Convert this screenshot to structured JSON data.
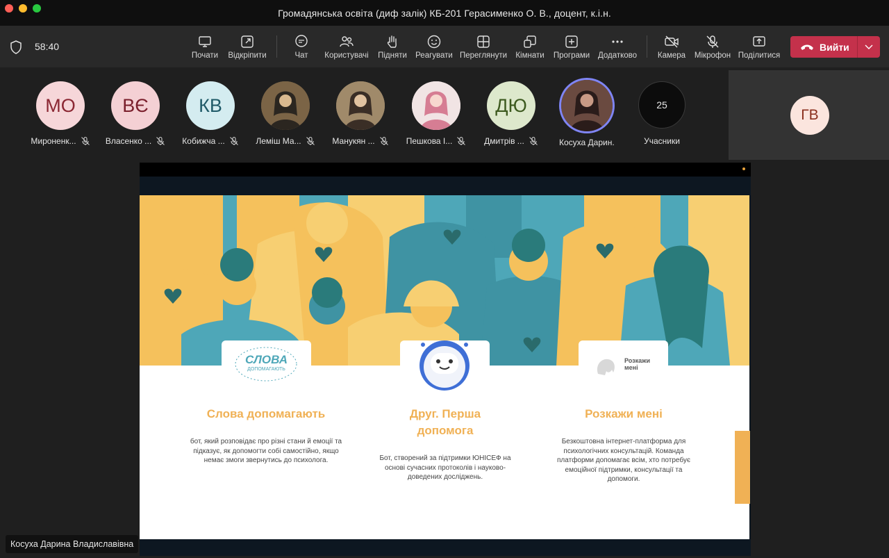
{
  "window": {
    "title": "Громадянська освіта (диф залік) КБ-201 Герасименко О. В., доцент, к.і.н."
  },
  "toolbar": {
    "timer": "58:40",
    "buttons": [
      {
        "id": "start",
        "label": "Почати",
        "icon": "present-icon"
      },
      {
        "id": "popout",
        "label": "Відкріпити",
        "icon": "pop-out-icon"
      },
      {
        "id": "chat",
        "label": "Чат",
        "icon": "chat-icon"
      },
      {
        "id": "people",
        "label": "Користувачі",
        "icon": "people-icon"
      },
      {
        "id": "raise",
        "label": "Підняти",
        "icon": "hand-icon"
      },
      {
        "id": "react",
        "label": "Реагувати",
        "icon": "smiley-icon"
      },
      {
        "id": "view",
        "label": "Переглянути",
        "icon": "grid-icon"
      },
      {
        "id": "rooms",
        "label": "Кімнати",
        "icon": "rooms-icon"
      },
      {
        "id": "apps",
        "label": "Програми",
        "icon": "plus-square-icon"
      },
      {
        "id": "more",
        "label": "Додатково",
        "icon": "more-icon"
      },
      {
        "id": "camera",
        "label": "Камера",
        "icon": "camera-off-icon"
      },
      {
        "id": "mic",
        "label": "Мікрофон",
        "icon": "mic-off-icon"
      },
      {
        "id": "share",
        "label": "Поділитися",
        "icon": "share-icon"
      }
    ],
    "leave_label": "Вийти"
  },
  "participants": [
    {
      "initials": "МО",
      "name": "Мироненк...",
      "bg": "#f6d6d9",
      "fg": "#8b2733",
      "photo": false
    },
    {
      "initials": "ВЄ",
      "name": "Власенко ...",
      "bg": "#f4d0d4",
      "fg": "#7a1f2c",
      "photo": false
    },
    {
      "initials": "КВ",
      "name": "Кобижча ...",
      "bg": "#d4ecf0",
      "fg": "#1f5a68",
      "photo": false
    },
    {
      "initials": "",
      "name": "Леміш Ма...",
      "bg": "#6b5a3e",
      "fg": "#fff",
      "photo": true
    },
    {
      "initials": "",
      "name": "Манукян ...",
      "bg": "#8a7760",
      "fg": "#fff",
      "photo": true
    },
    {
      "initials": "",
      "name": "Пешкова І...",
      "bg": "#e8d8d8",
      "fg": "#fff",
      "photo": true
    },
    {
      "initials": "ДЮ",
      "name": "Дмитрів ...",
      "bg": "#dde8cc",
      "fg": "#3d5a1f",
      "photo": false
    },
    {
      "initials": "",
      "name": "Косуха Дарин...",
      "bg": "#5a3a34",
      "fg": "#fff",
      "photo": true
    }
  ],
  "participants_count": {
    "value": "25",
    "label": "Учасники"
  },
  "self_tile": {
    "initials": "ГВ"
  },
  "slide": {
    "columns": [
      {
        "card_text": "СЛОВА",
        "card_sub": "ДОПОМАГАЮТЬ",
        "title": "Слова допомагають",
        "text": "бот, який розповідає про різні стани й емоції та підказує, як допомогти собі самостійно, якщо немає змоги звернутись до психолога."
      },
      {
        "card_text": "",
        "card_sub": "",
        "title": "Друг. Перша допомога",
        "text": "Бот, створений за підтримки ЮНІСЕФ на основі сучасних протоколів і науково-доведених досліджень."
      },
      {
        "card_text": "Розкажи",
        "card_sub": "мені",
        "title": "Розкажи мені",
        "text": "Безкоштовна інтернет-платформа для психологічних консультацій. Команда платформи допомагає всім, хто потребує емоційної підтримки, консультації та допомоги."
      }
    ]
  },
  "share_owner": "Косуха Дарина Владиславівна",
  "colors": {
    "leave": "#c4314b",
    "accent_yellow": "#f0b155",
    "teal": "#4ea7b8",
    "toolbar": "#292929"
  }
}
